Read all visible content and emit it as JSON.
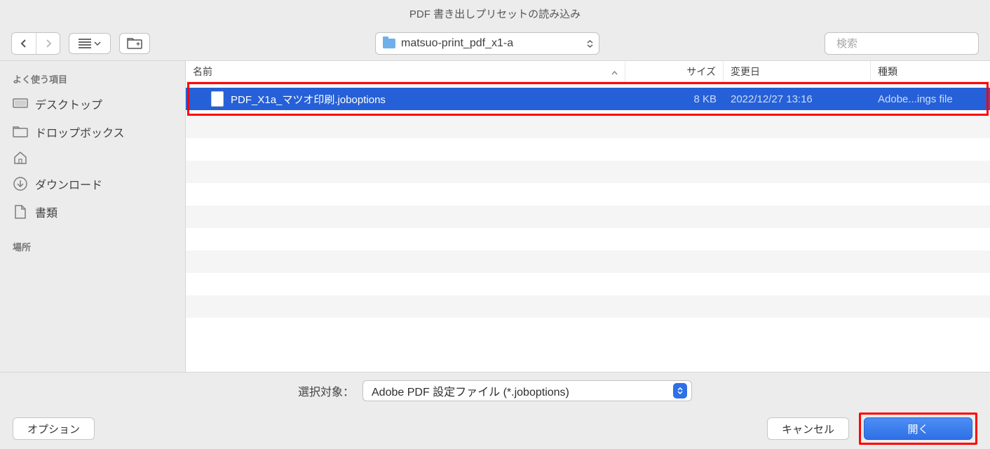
{
  "window": {
    "title": "PDF 書き出しプリセットの読み込み"
  },
  "toolbar": {
    "path_label": "matsuo-print_pdf_x1-a",
    "search_placeholder": "検索"
  },
  "sidebar": {
    "sections": [
      {
        "title": "よく使う項目",
        "items": [
          {
            "label": "デスクトップ",
            "icon": "desktop"
          },
          {
            "label": "ドロップボックス",
            "icon": "folder"
          },
          {
            "label": "",
            "icon": "home"
          },
          {
            "label": "ダウンロード",
            "icon": "download"
          },
          {
            "label": "書類",
            "icon": "document"
          }
        ]
      },
      {
        "title": "場所",
        "items": []
      }
    ]
  },
  "columns": {
    "name": "名前",
    "size": "サイズ",
    "modified": "変更日",
    "kind": "種類"
  },
  "files": [
    {
      "name": "PDF_X1a_マツオ印刷.joboptions",
      "size": "8 KB",
      "modified": "2022/12/27 13:16",
      "kind": "Adobe...ings file",
      "selected": true
    }
  ],
  "filter": {
    "label": "選択対象：",
    "value": "Adobe PDF 設定ファイル (*.joboptions)"
  },
  "buttons": {
    "options": "オプション",
    "cancel": "キャンセル",
    "open": "開く"
  }
}
